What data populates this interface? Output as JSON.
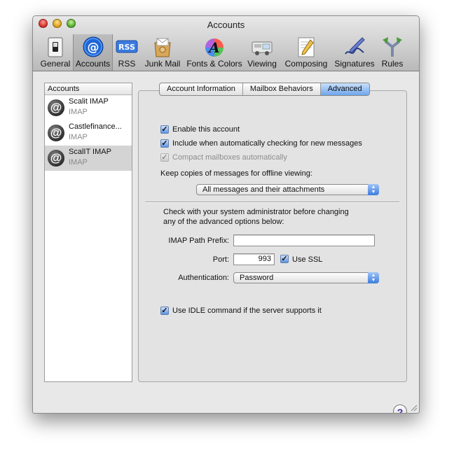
{
  "window": {
    "title": "Accounts"
  },
  "toolbar": {
    "items": [
      {
        "label": "General",
        "icon": "general-switch-icon"
      },
      {
        "label": "Accounts",
        "icon": "at-sign-icon",
        "selected": true
      },
      {
        "label": "RSS",
        "icon": "rss-icon",
        "badge": "RSS"
      },
      {
        "label": "Junk Mail",
        "icon": "junk-mail-icon"
      },
      {
        "label": "Fonts & Colors",
        "icon": "fonts-colors-icon",
        "glyph": "A"
      },
      {
        "label": "Viewing",
        "icon": "viewing-icon"
      },
      {
        "label": "Composing",
        "icon": "composing-icon"
      },
      {
        "label": "Signatures",
        "icon": "signatures-icon"
      },
      {
        "label": "Rules",
        "icon": "rules-icon"
      }
    ]
  },
  "sidebar": {
    "header": "Accounts",
    "accounts": [
      {
        "name": "Scalit IMAP",
        "type": "IMAP",
        "selected": false
      },
      {
        "name": "Castlefinance...",
        "type": "IMAP",
        "selected": false
      },
      {
        "name": "ScalIT IMAP",
        "type": "IMAP",
        "selected": true
      }
    ],
    "add_label": "+",
    "remove_label": "−"
  },
  "tabs": [
    {
      "label": "Account Information",
      "active": false
    },
    {
      "label": "Mailbox Behaviors",
      "active": false
    },
    {
      "label": "Advanced",
      "active": true
    }
  ],
  "advanced": {
    "enable_account": {
      "label": "Enable this account",
      "checked": true
    },
    "include_auto_check": {
      "label": "Include when automatically checking for new messages",
      "checked": true
    },
    "compact_mailboxes": {
      "label": "Compact mailboxes automatically",
      "checked": true,
      "disabled": true
    },
    "offline_label": "Keep copies of messages for offline viewing:",
    "offline_value": "All messages and their attachments",
    "admin_note_line1": "Check with your system administrator before changing",
    "admin_note_line2": "any of the advanced options below:",
    "imap_prefix_label": "IMAP Path Prefix:",
    "imap_prefix_value": "",
    "port_label": "Port:",
    "port_value": "993",
    "use_ssl": {
      "label": "Use SSL",
      "checked": true
    },
    "auth_label": "Authentication:",
    "auth_value": "Password",
    "idle": {
      "label": "Use IDLE command if the server supports it",
      "checked": true
    }
  },
  "help_label": "?",
  "colors": {
    "accent": "#5d93e0",
    "selection": "#d4d4d4",
    "help": "#4b2a9e"
  }
}
